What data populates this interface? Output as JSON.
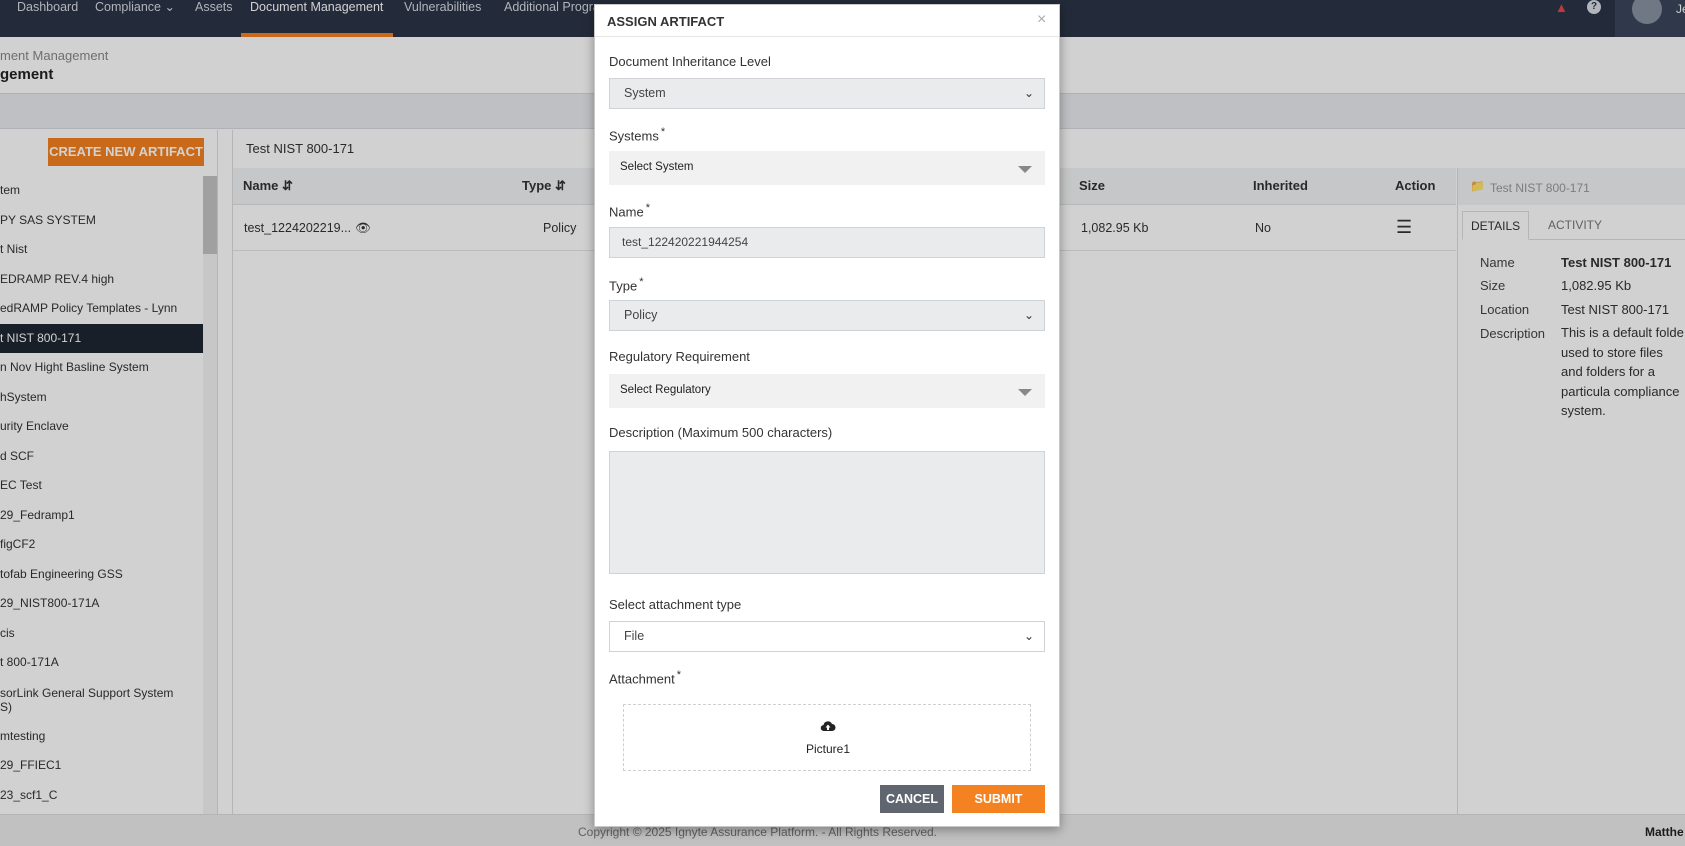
{
  "nav": {
    "items": [
      "Dashboard",
      "Compliance",
      "Assets",
      "Document Management",
      "Vulnerabilities",
      "Additional Progra"
    ],
    "active": "Document Management",
    "user_initial": "Je"
  },
  "page": {
    "breadcrumb": "ment Management",
    "title": "gement"
  },
  "left": {
    "create_button": "CREATE NEW ARTIFACT",
    "items": [
      "tem",
      "PY SAS SYSTEM",
      "t Nist",
      "EDRAMP REV.4 high",
      "edRAMP Policy Templates - Lynn",
      "t NIST 800-171",
      "n Nov Hight Basline System",
      "hSystem",
      "urity Enclave",
      "d SCF",
      "EC Test",
      "29_Fedramp1",
      "figCF2",
      "tofab Engineering GSS",
      "29_NIST800-171A",
      "cis",
      "t 800-171A",
      "sorLink General Support System\nS)",
      "mtesting",
      "29_FFIEC1",
      "23_scf1_C"
    ],
    "selected_index": 5
  },
  "table": {
    "folder_title": "Test NIST 800-171",
    "headers": {
      "name": "Name",
      "type": "Type",
      "size": "Size",
      "inherited": "Inherited",
      "action": "Action"
    },
    "rows": [
      {
        "name": "test_1224202219...",
        "type": "Policy",
        "size": "1,082.95 Kb",
        "inherited": "No"
      }
    ]
  },
  "details": {
    "folder": "Test NIST 800-171",
    "tabs": [
      "DETAILS",
      "ACTIVITY"
    ],
    "active_tab": "DETAILS",
    "fields": [
      {
        "label": "Name",
        "value": "Test NIST 800-171"
      },
      {
        "label": "Size",
        "value": "1,082.95 Kb"
      },
      {
        "label": "Location",
        "value": "Test NIST 800-171"
      },
      {
        "label": "Description",
        "value": "This is a default folde used to store files and folders for a particula compliance system."
      }
    ]
  },
  "footer": {
    "copyright": "Copyright © 2025 Ignyte Assurance Platform. - All Rights Reserved.",
    "user": "Matthe"
  },
  "modal": {
    "title": "ASSIGN ARTIFACT",
    "close": "×",
    "inheritance_label": "Document Inheritance Level",
    "inheritance_value": "System",
    "systems_label": "Systems",
    "systems_placeholder": "Select System",
    "name_label": "Name",
    "name_value": "test_122420221944254",
    "type_label": "Type",
    "type_value": "Policy",
    "regulatory_label": "Regulatory Requirement",
    "regulatory_placeholder": "Select Regulatory",
    "description_label": "Description (Maximum 500 characters)",
    "description_value": "",
    "attachment_type_label": "Select attachment type",
    "attachment_type_value": "File",
    "attachment_label": "Attachment",
    "required_mark": "*",
    "attachment_file": "Picture1",
    "cancel": "CANCEL",
    "submit": "SUBMIT"
  },
  "colors": {
    "nav_bg": "#2b3446",
    "accent": "#f58220",
    "cancel_bg": "#5f6670",
    "selected_bg": "#1f2633"
  }
}
